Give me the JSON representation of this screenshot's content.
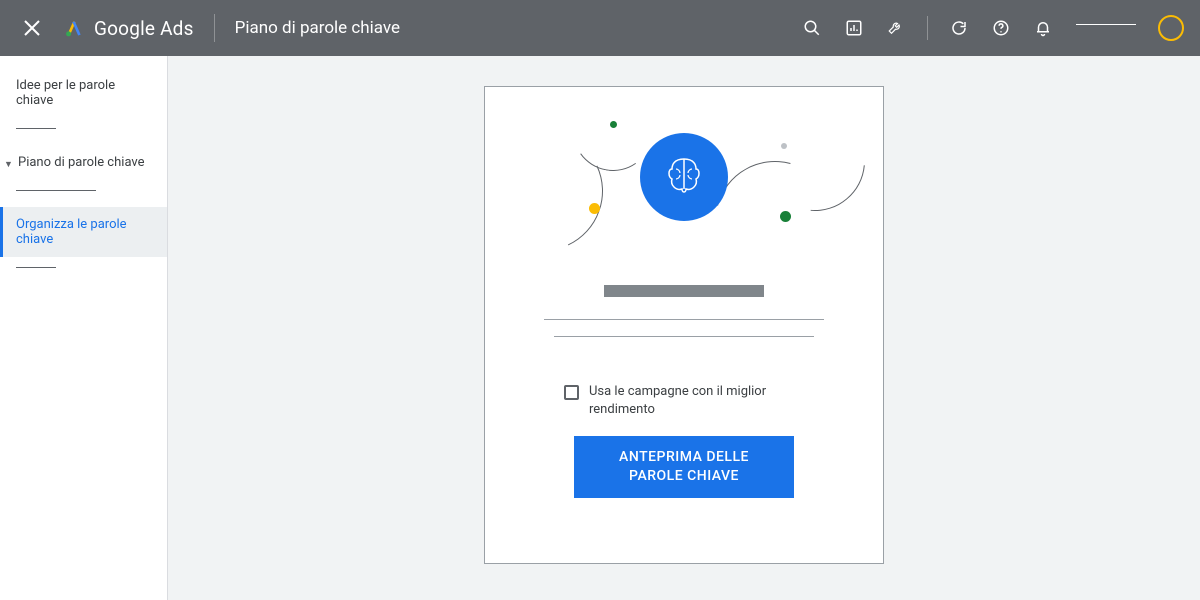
{
  "header": {
    "product": "Google Ads",
    "page_title": "Piano di parole chiave"
  },
  "sidebar": {
    "item_ideas": "Idee per le parole chiave",
    "item_plan": "Piano di parole chiave",
    "item_organize": "Organizza le parole chiave"
  },
  "card": {
    "checkbox_label": "Usa le campagne con il miglior rendimento",
    "primary_button": "ANTEPRIMA DELLE PAROLE CHIAVE"
  }
}
